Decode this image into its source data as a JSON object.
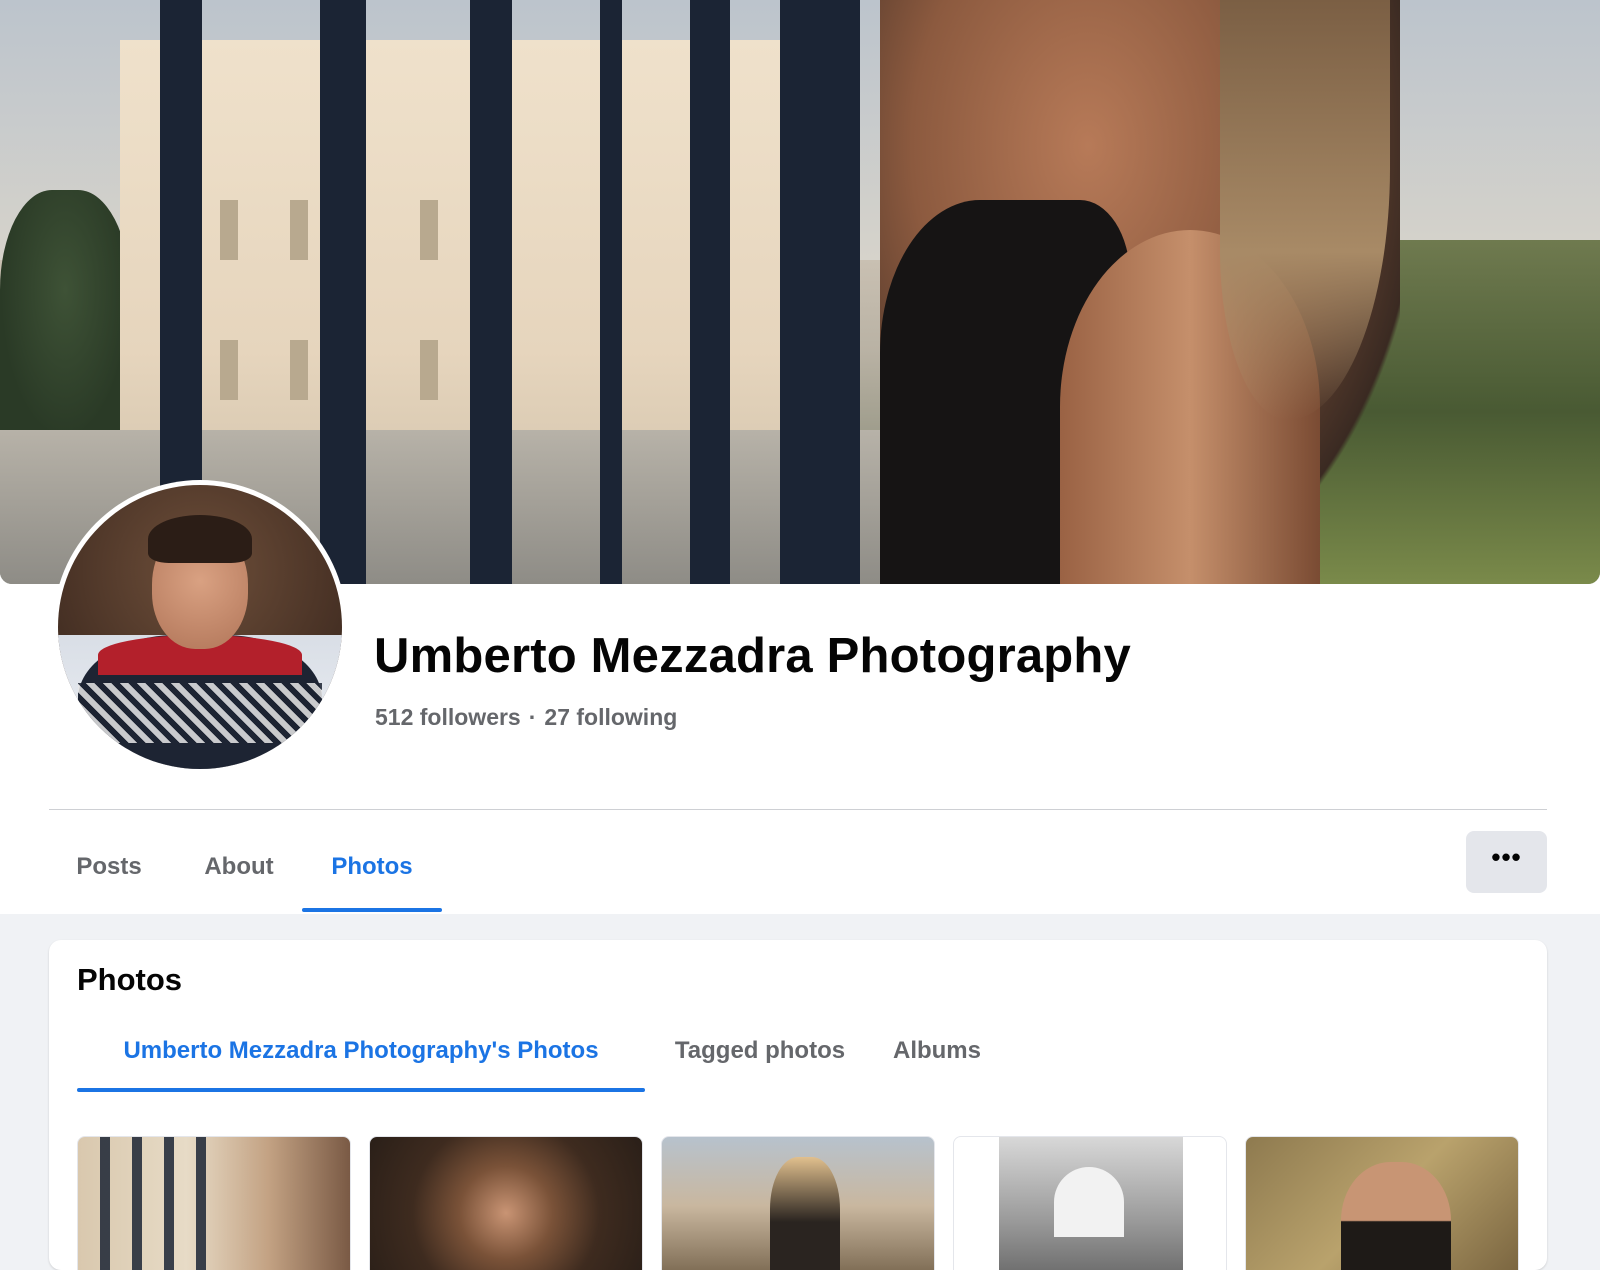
{
  "profile": {
    "name": "Umberto Mezzadra Photography",
    "followers": "512 followers",
    "separator": "·",
    "following": "27 following"
  },
  "tabs": [
    {
      "label": "Posts",
      "active": false
    },
    {
      "label": "About",
      "active": false
    },
    {
      "label": "Photos",
      "active": true
    }
  ],
  "more_button": {
    "label": "•••",
    "icon": "more-horizontal-icon"
  },
  "photos_section": {
    "title": "Photos",
    "subtabs": [
      {
        "label": "Umberto Mezzadra Photography's Photos",
        "active": true
      },
      {
        "label": "Tagged photos",
        "active": false
      },
      {
        "label": "Albums",
        "active": false
      }
    ]
  },
  "colors": {
    "accent": "#1b74e4",
    "text_primary": "#050505",
    "text_secondary": "#65676b",
    "page_bg": "#f0f2f5",
    "button_bg": "#e4e6eb"
  }
}
